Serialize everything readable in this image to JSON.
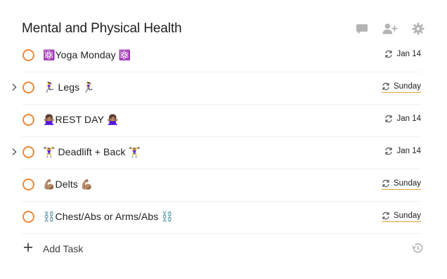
{
  "project": {
    "title": "Mental and Physical Health"
  },
  "header_actions": [
    {
      "icon": "comment-icon"
    },
    {
      "icon": "add-person-icon"
    },
    {
      "icon": "gear-icon"
    }
  ],
  "tasks": [
    {
      "content": "⚛️Yoga Monday ⚛️",
      "due": "Jan 14",
      "has_subtasks": false,
      "due_style": "normal"
    },
    {
      "content": "🏃‍♀️ Legs 🏃‍♀️",
      "due": "Sunday",
      "has_subtasks": true,
      "due_style": "upcoming"
    },
    {
      "content": "🙅🏽‍♀️REST DAY 🙅🏽‍♀️",
      "due": "Jan 14",
      "has_subtasks": false,
      "due_style": "normal"
    },
    {
      "content": "🏋️‍♀️ Deadlift + Back 🏋️‍♀️",
      "due": "Jan 14",
      "has_subtasks": true,
      "due_style": "normal"
    },
    {
      "content": "💪🏽Delts 💪🏽",
      "due": "Sunday",
      "has_subtasks": false,
      "due_style": "upcoming"
    },
    {
      "content": "⛓️Chest/Abs or Arms/Abs ⛓️",
      "due": "Sunday",
      "has_subtasks": false,
      "due_style": "upcoming"
    }
  ],
  "add_task": {
    "label": "Add Task"
  },
  "colors": {
    "priority_circle": "#eb8a3e",
    "upcoming_underline": "#e0a330",
    "icon_gray": "#b0b0b0"
  }
}
